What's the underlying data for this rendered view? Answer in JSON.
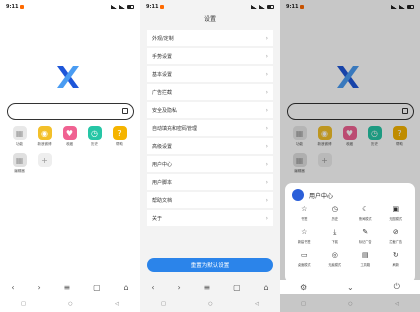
{
  "status": {
    "time": "9:11"
  },
  "home": {
    "shortcuts": [
      {
        "label": "功能",
        "icon": "apps-icon",
        "color": "#e8e8e8",
        "glyph": "▦"
      },
      {
        "label": "新浪微博",
        "icon": "weibo-icon",
        "color": "#f3c02a",
        "glyph": "◉"
      },
      {
        "label": "收藏",
        "icon": "heart-icon",
        "color": "#f06292",
        "glyph": "♥"
      },
      {
        "label": "历史",
        "icon": "clock-icon",
        "color": "#26c6a6",
        "glyph": "◷"
      },
      {
        "label": "帮助",
        "icon": "help-icon",
        "color": "#f5b400",
        "glyph": "?"
      },
      {
        "label": "编辑器",
        "icon": "editor-icon",
        "color": "#e0e0e0",
        "glyph": "▦"
      },
      {
        "label": "",
        "icon": "add-icon",
        "color": "#eeeeee",
        "glyph": "+"
      }
    ]
  },
  "settings": {
    "title": "设置",
    "items": [
      "外观/定制",
      "手势设置",
      "基本设置",
      "广告拦截",
      "安全及隐私",
      "自动填充和密码管理",
      "高级设置",
      "用户中心",
      "用户脚本",
      "帮助文档",
      "关于"
    ],
    "reset_label": "重置为默认设置"
  },
  "menu": {
    "user_center": "用户中心",
    "items": [
      {
        "label": "书签",
        "glyph": "☆",
        "icon": "star-icon"
      },
      {
        "label": "历史",
        "glyph": "◷",
        "icon": "history-icon"
      },
      {
        "label": "夜间模式",
        "glyph": "☾",
        "icon": "moon-icon"
      },
      {
        "label": "无图模式",
        "glyph": "▣",
        "icon": "image-off-icon"
      },
      {
        "label": "新建书签",
        "glyph": "☆",
        "icon": "star-outline-icon"
      },
      {
        "label": "下载",
        "glyph": "⤓",
        "icon": "download-icon"
      },
      {
        "label": "标记广告",
        "glyph": "✎",
        "icon": "mark-ad-icon"
      },
      {
        "label": "拦截广告",
        "glyph": "⊘",
        "icon": "block-icon"
      },
      {
        "label": "桌面模式",
        "glyph": "▭",
        "icon": "desktop-icon"
      },
      {
        "label": "无痕模式",
        "glyph": "◎",
        "icon": "incognito-icon"
      },
      {
        "label": "工具箱",
        "glyph": "▤",
        "icon": "toolbox-icon"
      },
      {
        "label": "刷新",
        "glyph": "↻",
        "icon": "refresh-icon"
      }
    ]
  },
  "colors": {
    "accent": "#2b84ea",
    "logo_blue": "#1e56d9",
    "logo_light": "#4a9cf2"
  }
}
